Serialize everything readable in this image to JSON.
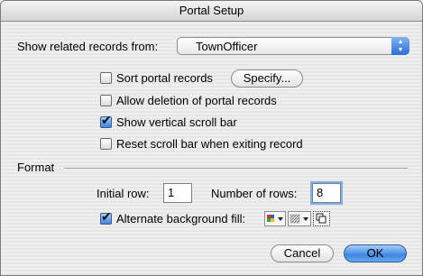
{
  "window": {
    "title": "Portal Setup"
  },
  "related": {
    "label": "Show related records from:",
    "value": "TownOfficer"
  },
  "options": {
    "sort": {
      "label": "Sort portal records",
      "checked": false,
      "button": "Specify..."
    },
    "allow_delete": {
      "label": "Allow deletion of portal records",
      "checked": false
    },
    "scroll_bar": {
      "label": "Show vertical scroll bar",
      "checked": true
    },
    "reset_scroll": {
      "label": "Reset scroll bar when exiting record",
      "checked": false
    }
  },
  "format": {
    "heading": "Format",
    "initial_row_label": "Initial row:",
    "initial_row_value": "1",
    "num_rows_label": "Number of rows:",
    "num_rows_value": "8",
    "alt_fill": {
      "label": "Alternate background fill:",
      "checked": true
    }
  },
  "buttons": {
    "cancel": "Cancel",
    "ok": "OK"
  },
  "colors": {
    "accent": "#3f86e0",
    "focus_ring": "#7eb1ec"
  }
}
